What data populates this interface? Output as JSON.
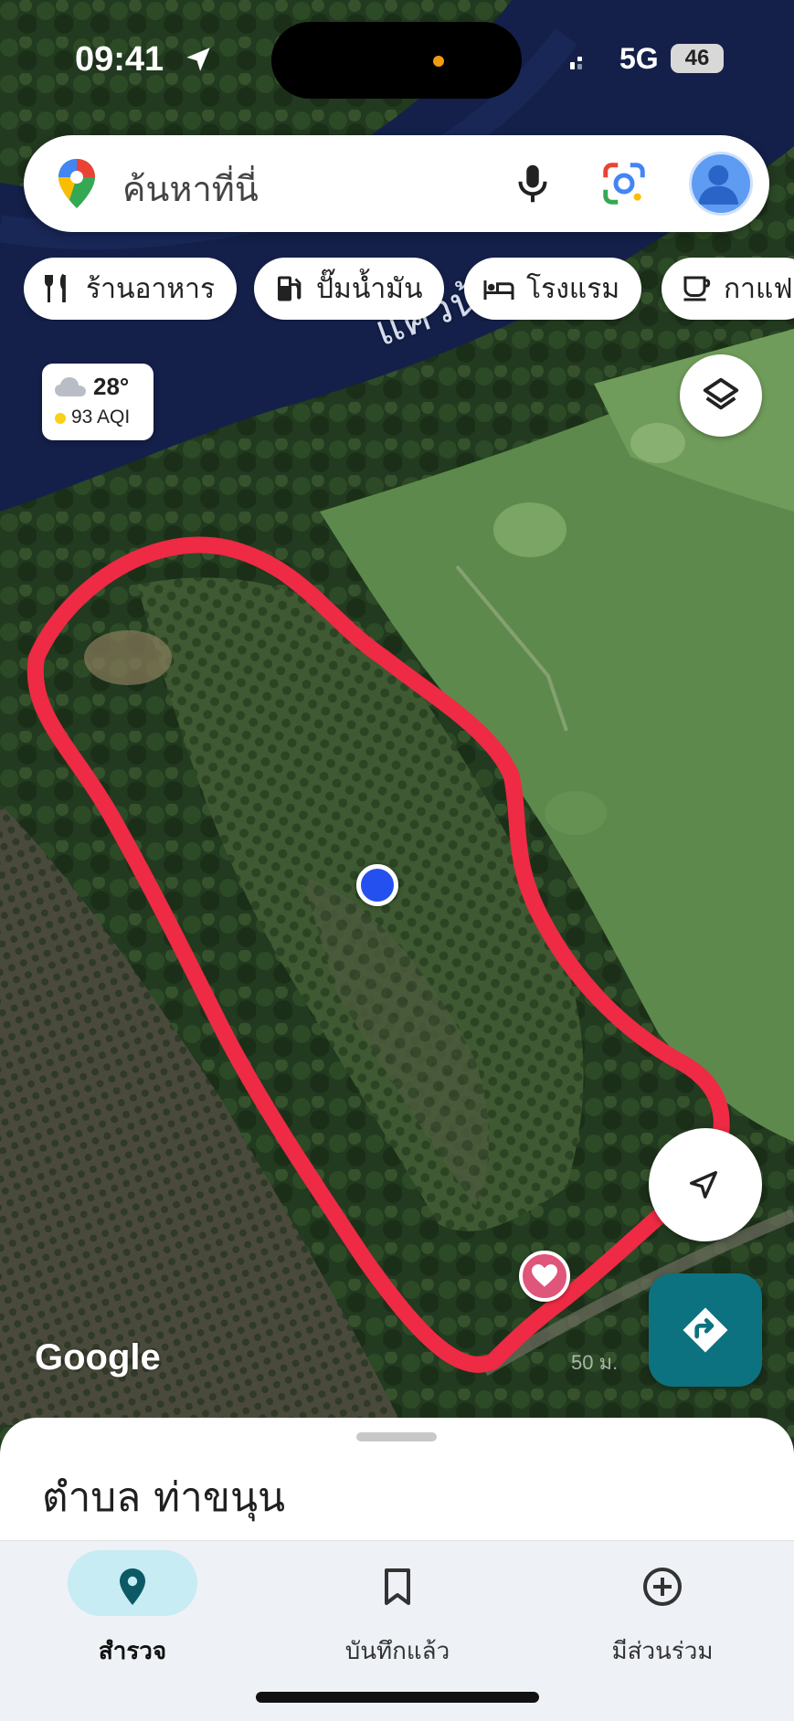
{
  "status_bar": {
    "time": "09:41",
    "network": "5G",
    "battery": "46"
  },
  "search": {
    "placeholder": "ค้นหาที่นี่"
  },
  "chips": [
    {
      "label": "ร้านอาหาร",
      "icon": "restaurant-icon"
    },
    {
      "label": "ปั๊มน้ำมัน",
      "icon": "gas-station-icon"
    },
    {
      "label": "โรงแรม",
      "icon": "hotel-icon"
    },
    {
      "label": "กาแฟ",
      "icon": "coffee-icon"
    }
  ],
  "weather": {
    "temperature": "28°",
    "aqi": "93 AQI",
    "icon": "cloud-icon"
  },
  "map": {
    "river_label": "แควน้",
    "attribution": "Google",
    "scale": "50 ม."
  },
  "place": {
    "title": "ตำบล ท่าขนุน"
  },
  "tabs": [
    {
      "label": "สำรวจ",
      "icon": "explore-pin-icon",
      "active": true
    },
    {
      "label": "บันทึกแล้ว",
      "icon": "bookmark-icon",
      "active": false
    },
    {
      "label": "มีส่วนร่วม",
      "icon": "add-circle-icon",
      "active": false
    }
  ],
  "colors": {
    "accent_teal": "#0d7280",
    "location_blue": "#2450f0",
    "annotation_red": "#ee2a44",
    "favorite_pink": "#e0557a"
  }
}
